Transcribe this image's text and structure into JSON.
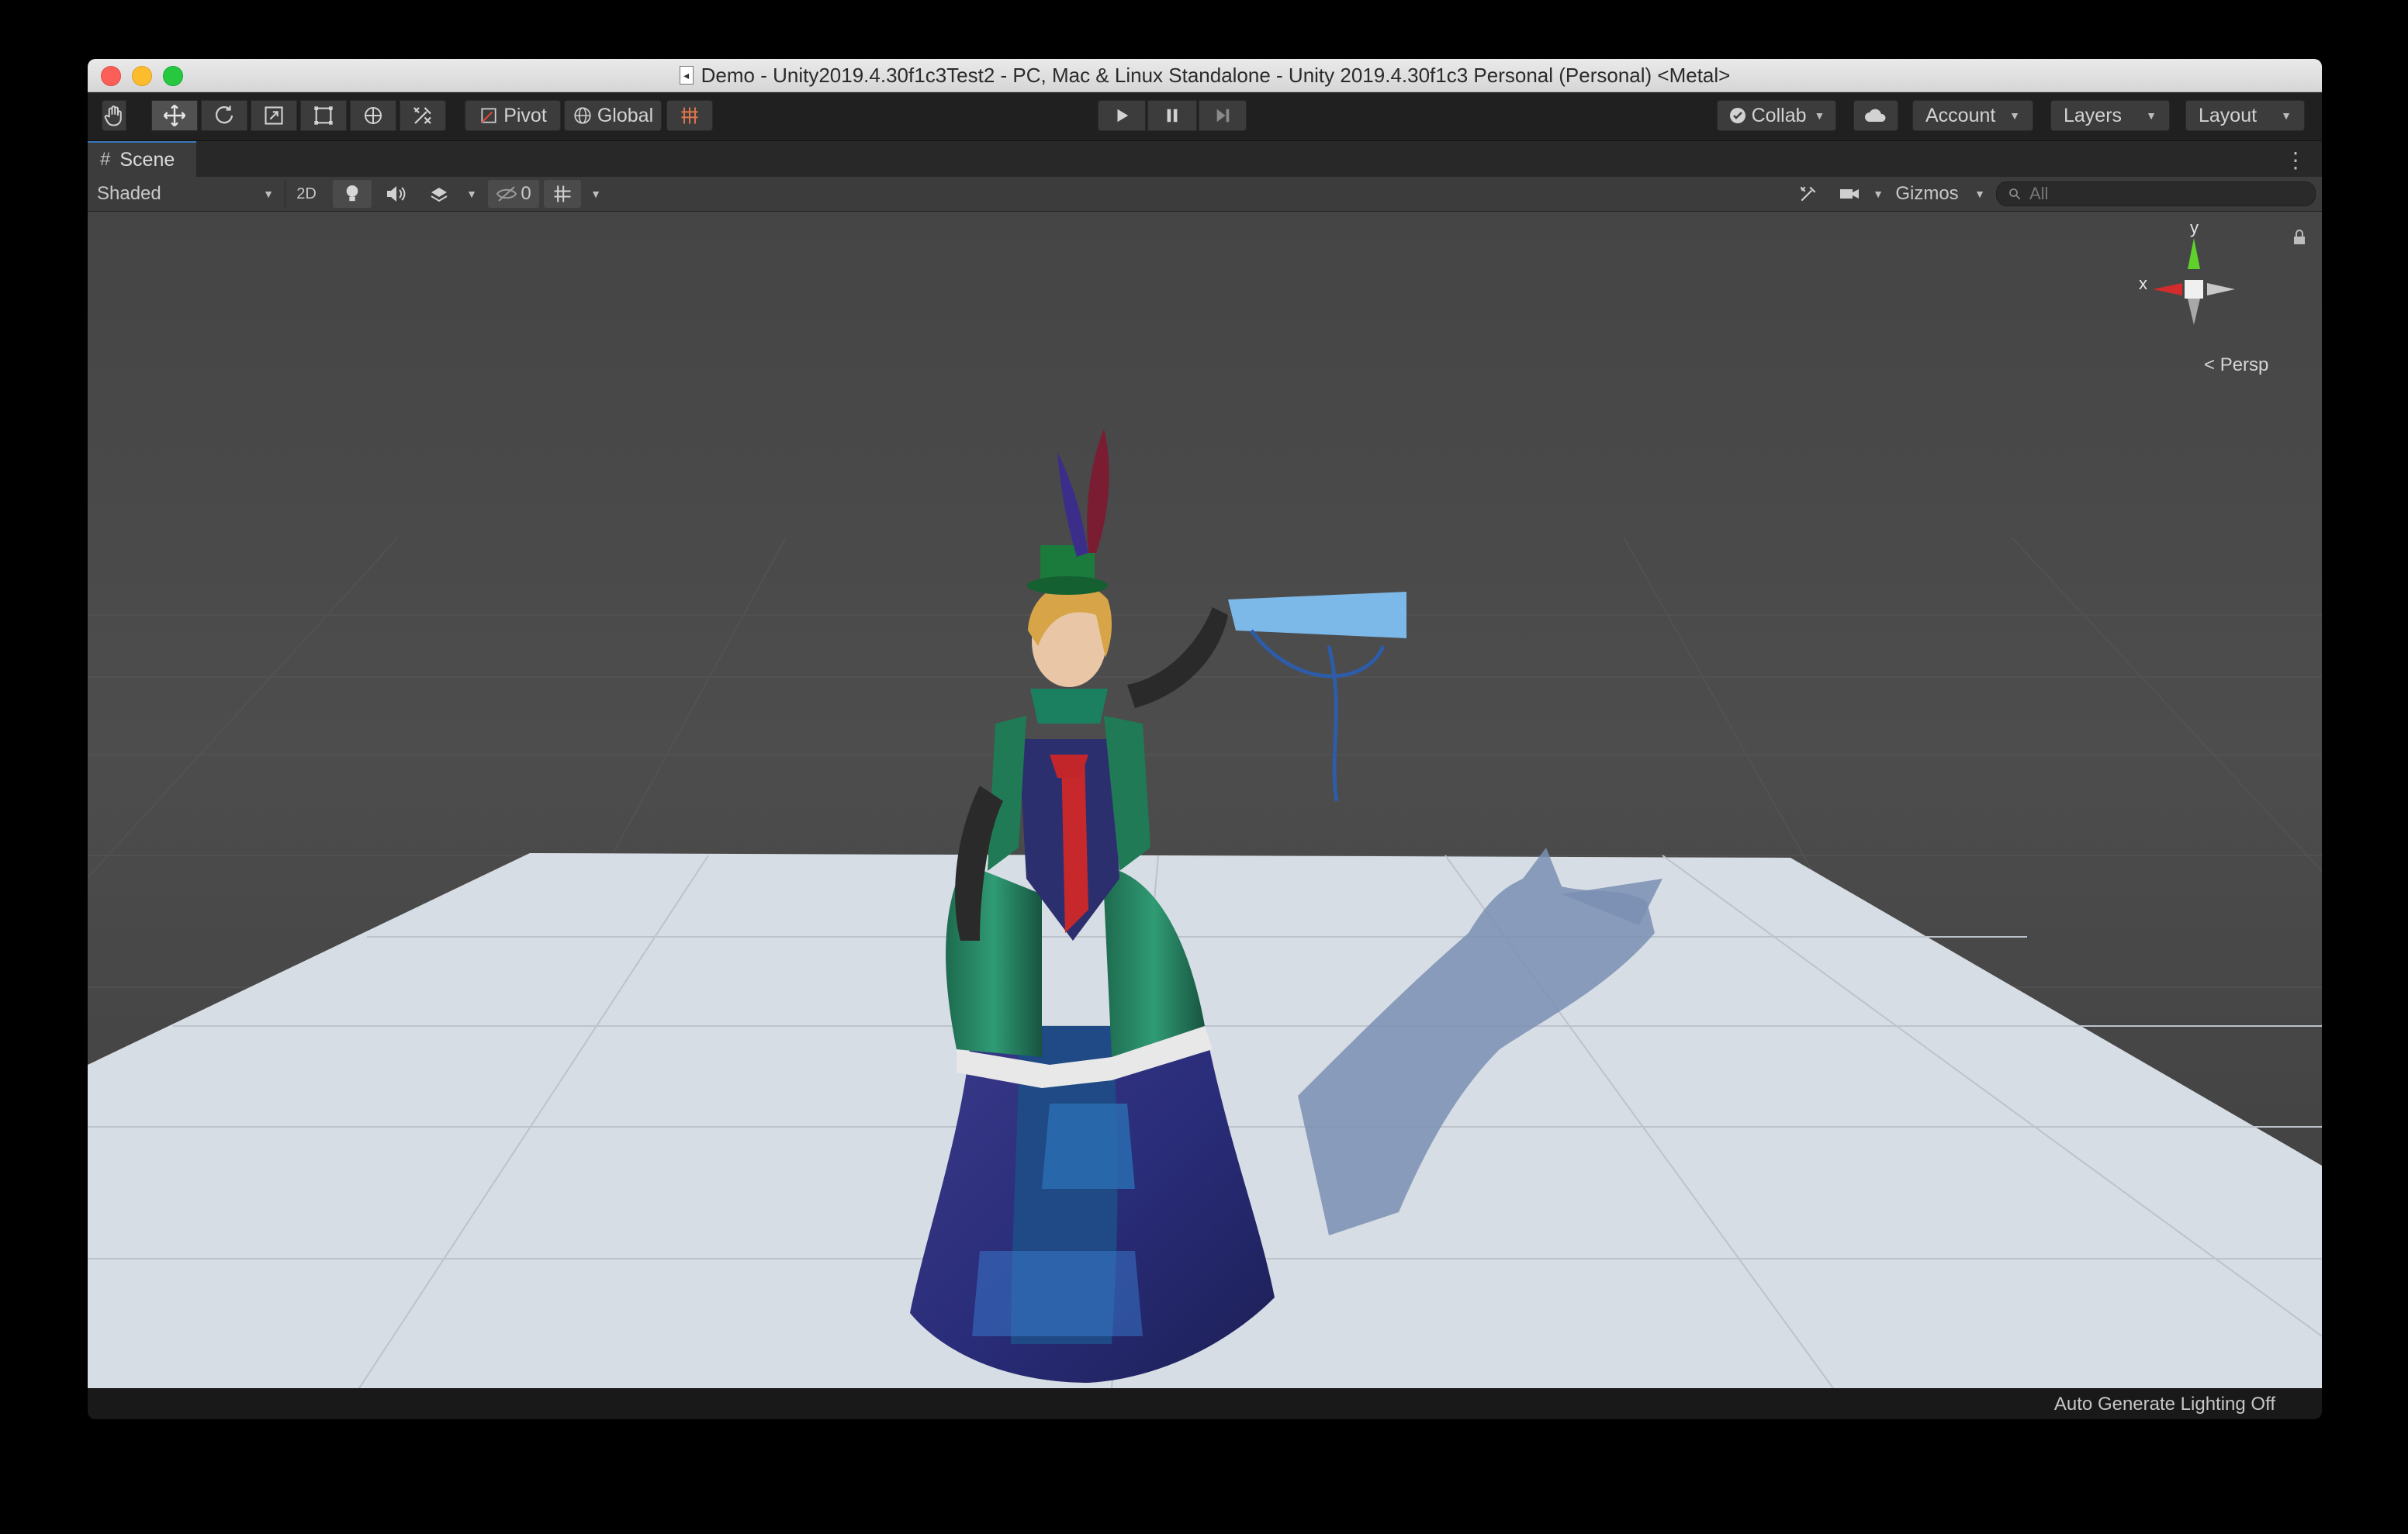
{
  "window": {
    "title": "Demo - Unity2019.4.30f1c3Test2 - PC, Mac & Linux Standalone - Unity 2019.4.30f1c3 Personal (Personal) <Metal>"
  },
  "toolbar": {
    "transform_tools": [
      "hand-tool",
      "move-tool",
      "rotate-tool",
      "scale-tool",
      "rect-tool",
      "transform-tool",
      "custom-editor-tool"
    ],
    "active_tool": "move-tool",
    "pivot_label": "Pivot",
    "global_label": "Global",
    "collab_label": "Collab",
    "account_label": "Account",
    "layers_label": "Layers",
    "layout_label": "Layout"
  },
  "scene_tab": {
    "label": "Scene"
  },
  "scene_toolbar": {
    "draw_mode": "Shaded",
    "mode_2d_label": "2D",
    "hidden_count": "0",
    "gizmos_label": "Gizmos",
    "search_placeholder": "All"
  },
  "gizmo": {
    "x_label": "x",
    "y_label": "y",
    "projection_label": "Persp",
    "colors": {
      "x": "#d42c2c",
      "y": "#5fd12c",
      "z": "#c8c8c8"
    }
  },
  "statusbar": {
    "text": "Auto Generate Lighting Off"
  },
  "colors": {
    "background": "#464646",
    "ground": "#d8dde5",
    "toolbar": "#202020"
  }
}
